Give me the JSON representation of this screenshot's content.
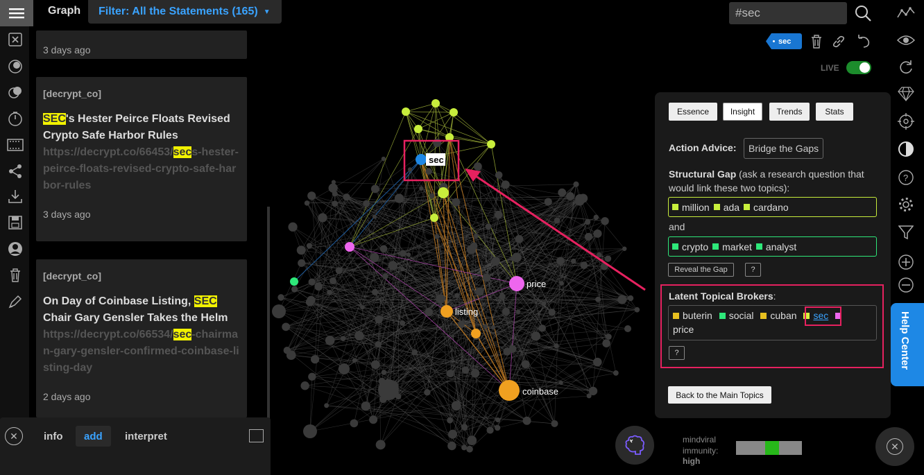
{
  "header": {
    "title": "Graph",
    "filter_label": "Filter: All the Statements (165)"
  },
  "search": {
    "value": "#sec"
  },
  "feed": {
    "card0": {
      "time": "3 days ago"
    },
    "card1": {
      "source": "[decrypt_co]",
      "headline_hl": "SEC",
      "headline_rest": "'s Hester Peirce Floats Revised Crypto Safe Harbor Rules",
      "link_pre": "https://decrypt.co/66453/",
      "link_hl": "sec",
      "link_post": "s-hester-peirce-floats-revised-crypto-safe-harbor-rules",
      "time": "3 days ago"
    },
    "card2": {
      "source": "[decrypt_co]",
      "headline_pre": "On Day of Coinbase Listing, ",
      "headline_hl": "SEC",
      "headline_post": " Chair Gary Gensler Takes the Helm",
      "link_pre": "https://decrypt.co/66534/",
      "link_hl": "sec",
      "link_post": "-chairman-gary-gensler-confirmed-coinbase-listing-day",
      "time": "2 days ago"
    }
  },
  "bottom_panel": {
    "tabs": [
      "info",
      "add",
      "interpret"
    ],
    "active": "add"
  },
  "tag_chip": "sec",
  "live_label": "LIVE",
  "insight": {
    "tabs": [
      "Essence",
      "Insight",
      "Trends",
      "Stats"
    ],
    "action_label": "Action Advice:",
    "action_value": "Bridge the Gaps",
    "gap_title": "Structural Gap",
    "gap_desc": " (ask a research question that would link these two topics):",
    "gap1": [
      "million",
      "ada",
      "cardano"
    ],
    "and_label": "and",
    "gap2": [
      "crypto",
      "market",
      "analyst"
    ],
    "reveal_label": "Reveal the Gap",
    "question_label": "?",
    "brokers_title": "Latent Topical Brokers",
    "brokers_colon": ":",
    "brokers": [
      {
        "label": "buterin",
        "color": "#e8c020"
      },
      {
        "label": "social",
        "color": "#2ee87a"
      },
      {
        "label": "cuban",
        "color": "#e8c020"
      },
      {
        "label": "sec",
        "color": "#d6f03c"
      },
      {
        "label": "price",
        "color": "#ee66ee"
      }
    ],
    "back_label": "Back to the Main Topics"
  },
  "help_center": "Help Center",
  "immunity": {
    "label": "mindviral immunity:",
    "level": "high",
    "value": 0.55
  },
  "graph": {
    "labels": {
      "sec": "sec",
      "price": "price",
      "listing": "listing",
      "coinbase": "coinbase"
    }
  },
  "colors": {
    "accent_blue": "#3aa3ff",
    "highlight": "#f2f200",
    "annotation": "#e6215f",
    "node_lime": "#c8ee3c",
    "node_orange": "#f0a020",
    "node_pink": "#ee66ee",
    "node_green": "#2ee87a",
    "node_blue": "#1e88e5"
  },
  "icons": [
    "hamburger-icon",
    "excel-icon",
    "circles-icon",
    "timer-icon",
    "film-icon",
    "share-icon",
    "download-icon",
    "save-icon",
    "user-icon",
    "trash-icon",
    "pen-icon",
    "search-icon",
    "link-icon",
    "undo-icon",
    "chart-line-icon",
    "eye-icon",
    "refresh-icon",
    "diamond-icon",
    "target-icon",
    "contrast-icon",
    "question-icon",
    "gear-icon",
    "funnel-icon",
    "zoom-in-icon",
    "zoom-out-icon",
    "brain-icon",
    "close-icon"
  ]
}
